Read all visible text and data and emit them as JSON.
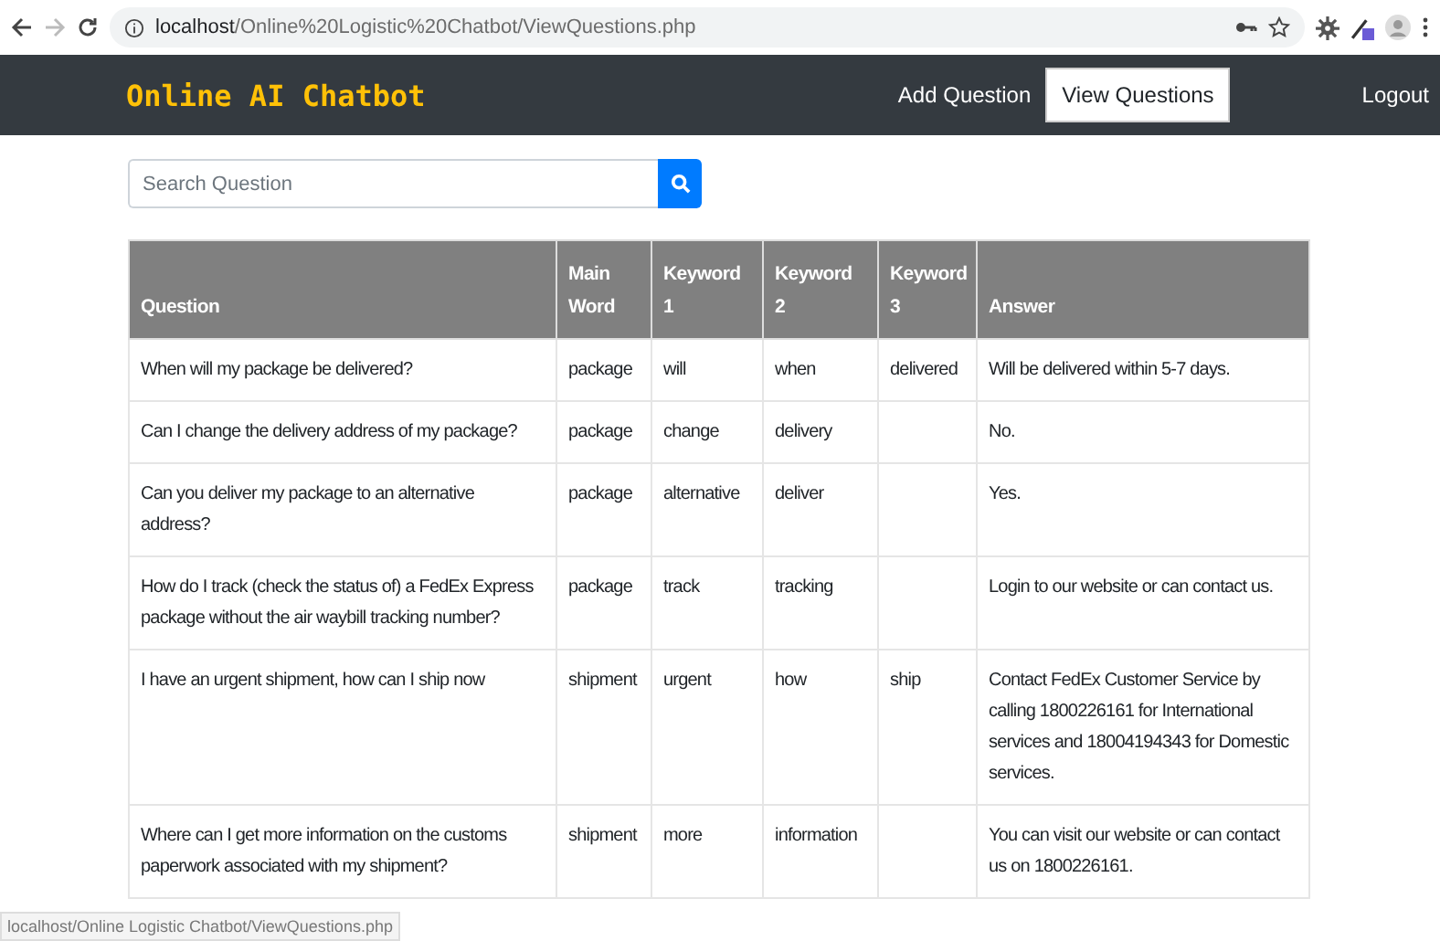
{
  "browser": {
    "url_host": "localhost",
    "url_path": "/Online%20Logistic%20Chatbot/ViewQuestions.php"
  },
  "navbar": {
    "brand": "Online AI Chatbot",
    "links": [
      {
        "label": "Add Question",
        "selected": false
      },
      {
        "label": "View Questions",
        "selected": true
      }
    ],
    "logout": "Logout"
  },
  "search": {
    "placeholder": "Search Question"
  },
  "table": {
    "columns": [
      "Question",
      "Main Word",
      "Keyword 1",
      "Keyword 2",
      "Keyword 3",
      "Answer"
    ],
    "rows": [
      [
        "When will my package be delivered?",
        "package",
        "will",
        "when",
        "delivered",
        "Will be delivered within 5-7 days."
      ],
      [
        "Can I change the delivery address of my package?",
        "package",
        "change",
        "delivery",
        "",
        "No."
      ],
      [
        "Can you deliver my package to an alternative address?",
        "package",
        "alternative",
        "deliver",
        "",
        "Yes."
      ],
      [
        "How do I track (check the status of) a FedEx Express package without the air waybill tracking number?",
        "package",
        "track",
        "tracking",
        "",
        "Login to our website or can contact us."
      ],
      [
        "I have an urgent shipment, how can I ship now",
        "shipment",
        "urgent",
        "how",
        "ship",
        "Contact FedEx Customer Service by calling 1800226161 for International services and 18004194343 for Domestic services."
      ],
      [
        "Where can I get more information on the customs paperwork associated with my shipment?",
        "shipment",
        "more",
        "information",
        "",
        "You can visit our website or can contact us on 1800226161."
      ]
    ]
  },
  "status_bar": "localhost/Online Logistic Chatbot/ViewQuestions.php"
}
